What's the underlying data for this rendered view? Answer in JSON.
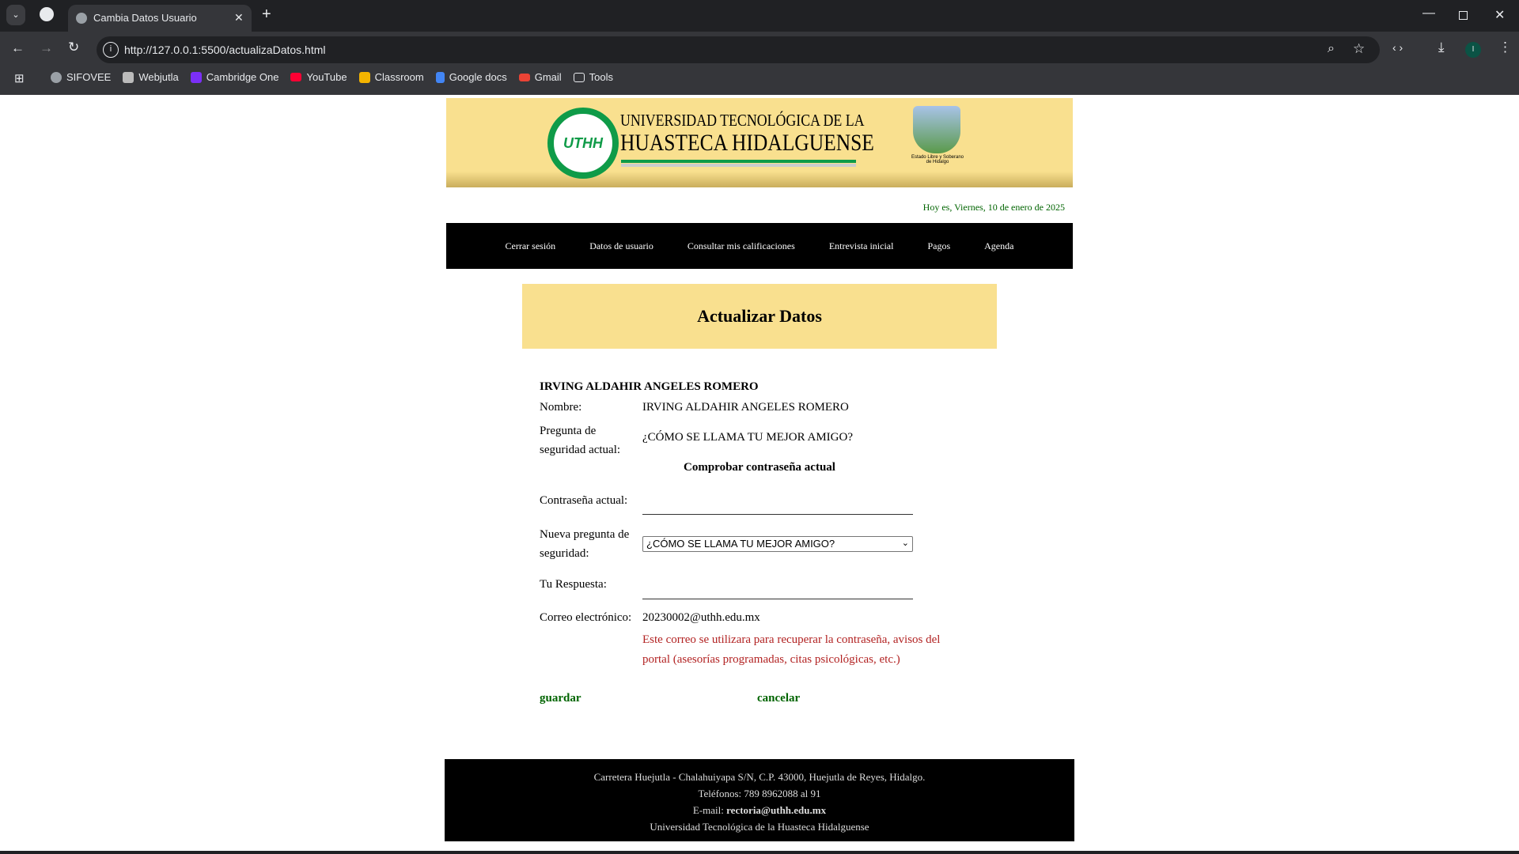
{
  "browser": {
    "tab_title": "Cambia Datos Usuario",
    "url": "http://127.0.0.1:5500/actualizaDatos.html",
    "bookmarks": [
      {
        "label": "SIFOVEE",
        "color": "#9aa0a6"
      },
      {
        "label": "Webjutla",
        "color": "#bbbbbb"
      },
      {
        "label": "Cambridge One",
        "color": "#7b2ff7"
      },
      {
        "label": "YouTube",
        "color": "#ff0033"
      },
      {
        "label": "Classroom",
        "color": "#f4b400"
      },
      {
        "label": "Google docs",
        "color": "#4285f4"
      },
      {
        "label": "Gmail",
        "color": "#ea4335"
      },
      {
        "label": "Tools",
        "color": "#35363a"
      }
    ],
    "profile_initial": "I"
  },
  "header": {
    "university_line1": "UNIVERSIDAD TECNOLÓGICA DE LA",
    "university_line2": "HUASTECA HIDALGUENSE",
    "logo_text": "UTHH",
    "state_caption": "Estado Libre y Soberano de Hidalgo"
  },
  "date_text": "Hoy es, Viernes, 10 de enero de 2025",
  "nav": [
    "Cerrar sesión",
    "Datos de usuario",
    "Consultar mis calificaciones",
    "Entrevista inicial",
    "Pagos",
    "Agenda"
  ],
  "page_title": "Actualizar Datos",
  "form": {
    "user_heading": "IRVING ALDAHIR ANGELES ROMERO",
    "name_label": "Nombre:",
    "name_value": "IRVING ALDAHIR ANGELES ROMERO",
    "question_label_1": "Pregunta de",
    "question_label_2": "seguridad actual:",
    "question_value": "¿CÓMO SE LLAMA TU MEJOR AMIGO?",
    "check_heading": "Comprobar contraseña actual",
    "password_label": "Contraseña actual:",
    "password_value": "",
    "new_question_label_1": "Nueva pregunta de",
    "new_question_label_2": "seguridad:",
    "new_question_selected": "¿CÓMO SE LLAMA TU MEJOR AMIGO?",
    "answer_label": "Tu Respuesta:",
    "answer_value": "",
    "email_label": "Correo electrónico:",
    "email_value": "20230002@uthh.edu.mx",
    "email_note_1": "Este correo se utilizara para recuperar la contraseña, avisos del",
    "email_note_2": "portal (asesorías programadas, citas psicológicas, etc.)",
    "save_label": "guardar",
    "cancel_label": "cancelar"
  },
  "footer": {
    "address": "Carretera Huejutla - Chalahuiyapa S/N, C.P. 43000, Huejutla de Reyes, Hidalgo.",
    "phones": "Teléfonos: 789 8962088 al 91",
    "email_prefix": "E-mail: ",
    "email": "rectoria@uthh.edu.mx",
    "name": "Universidad Tecnológica de la Huasteca Hidalguense"
  }
}
